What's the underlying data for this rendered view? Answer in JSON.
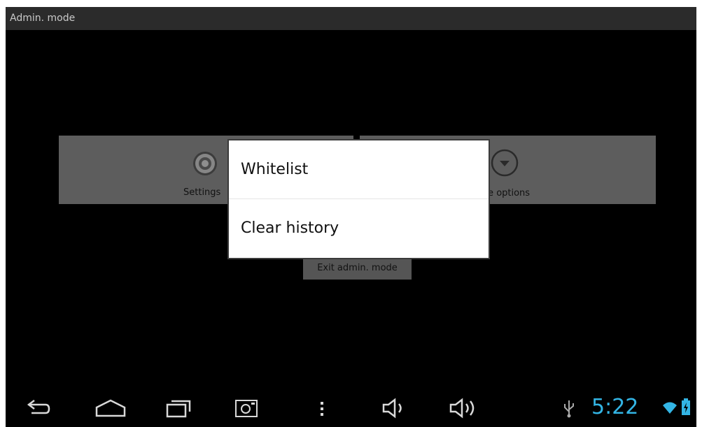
{
  "titlebar": {
    "title": "Admin. mode"
  },
  "tiles": {
    "settings_label": "Settings",
    "more_options_label": "re options"
  },
  "menu": {
    "items": [
      {
        "label": "Whitelist"
      },
      {
        "label": "Clear history"
      }
    ]
  },
  "exit_button": {
    "label": "Exit admin. mode"
  },
  "statusbar": {
    "time": "5:22",
    "accent_color": "#33b5e5"
  },
  "navbar": {
    "icons": [
      "back-icon",
      "home-icon",
      "recent-apps-icon",
      "screenshot-icon",
      "menu-icon",
      "volume-down-icon",
      "volume-up-icon",
      "usb-icon",
      "wifi-icon",
      "battery-icon"
    ]
  }
}
